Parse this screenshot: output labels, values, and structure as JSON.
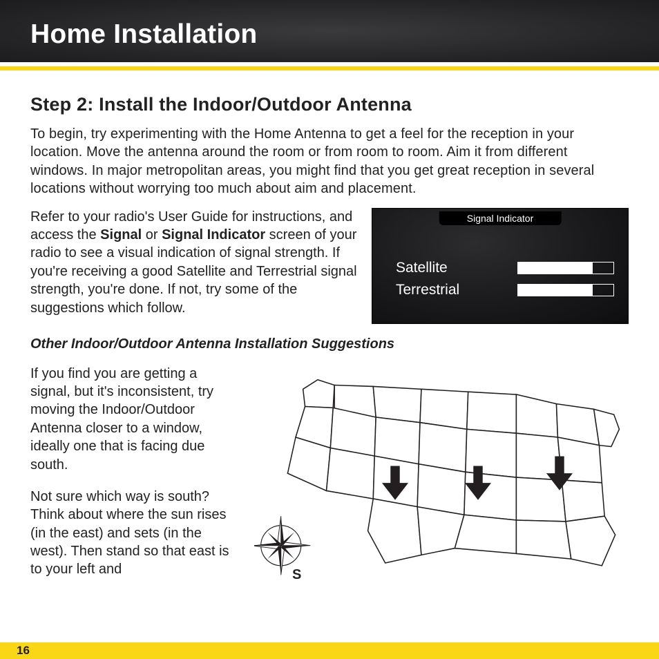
{
  "header": {
    "title": "Home Installation"
  },
  "step": {
    "heading": "Step 2: Install the Indoor/Outdoor Antenna"
  },
  "paragraphs": {
    "p1": "To begin, try experimenting with the Home Antenna to get a feel for the reception in your location. Move the antenna around the room or from room to room. Aim it from different windows. In major metropolitan areas, you might find that you get great reception in several locations without worrying too much about aim and placement.",
    "p2_a": "Refer to your radio's User Guide for instructions, and access the ",
    "p2_bold1": "Signal",
    "p2_b": " or ",
    "p2_bold2": "Signal Indicator",
    "p2_c": " screen of your radio to see a visual indication of signal strength. If you're receiving a good Satellite and Terrestrial signal strength, you're done. If not, try some of the suggestions which follow.",
    "p3": "If you find you are getting a signal, but it's inconsistent, try moving the Indoor/Outdoor Antenna closer to a window, ideally one that is facing due south.",
    "p4": "Not sure which way is south? Think about where the sun rises (in the east) and sets (in the west). Then stand so that east is to your left and"
  },
  "subhead": "Other Indoor/Outdoor Antenna Installation Suggestions",
  "signal": {
    "title": "Signal Indicator",
    "rows": [
      {
        "label": "Satellite",
        "level": 0.78
      },
      {
        "label": "Terrestrial",
        "level": 0.78
      }
    ]
  },
  "compass": {
    "south_label": "S"
  },
  "page_number": "16",
  "colors": {
    "accent": "#f9d616",
    "header_bg": "#2a2a2a",
    "text": "#222222"
  }
}
